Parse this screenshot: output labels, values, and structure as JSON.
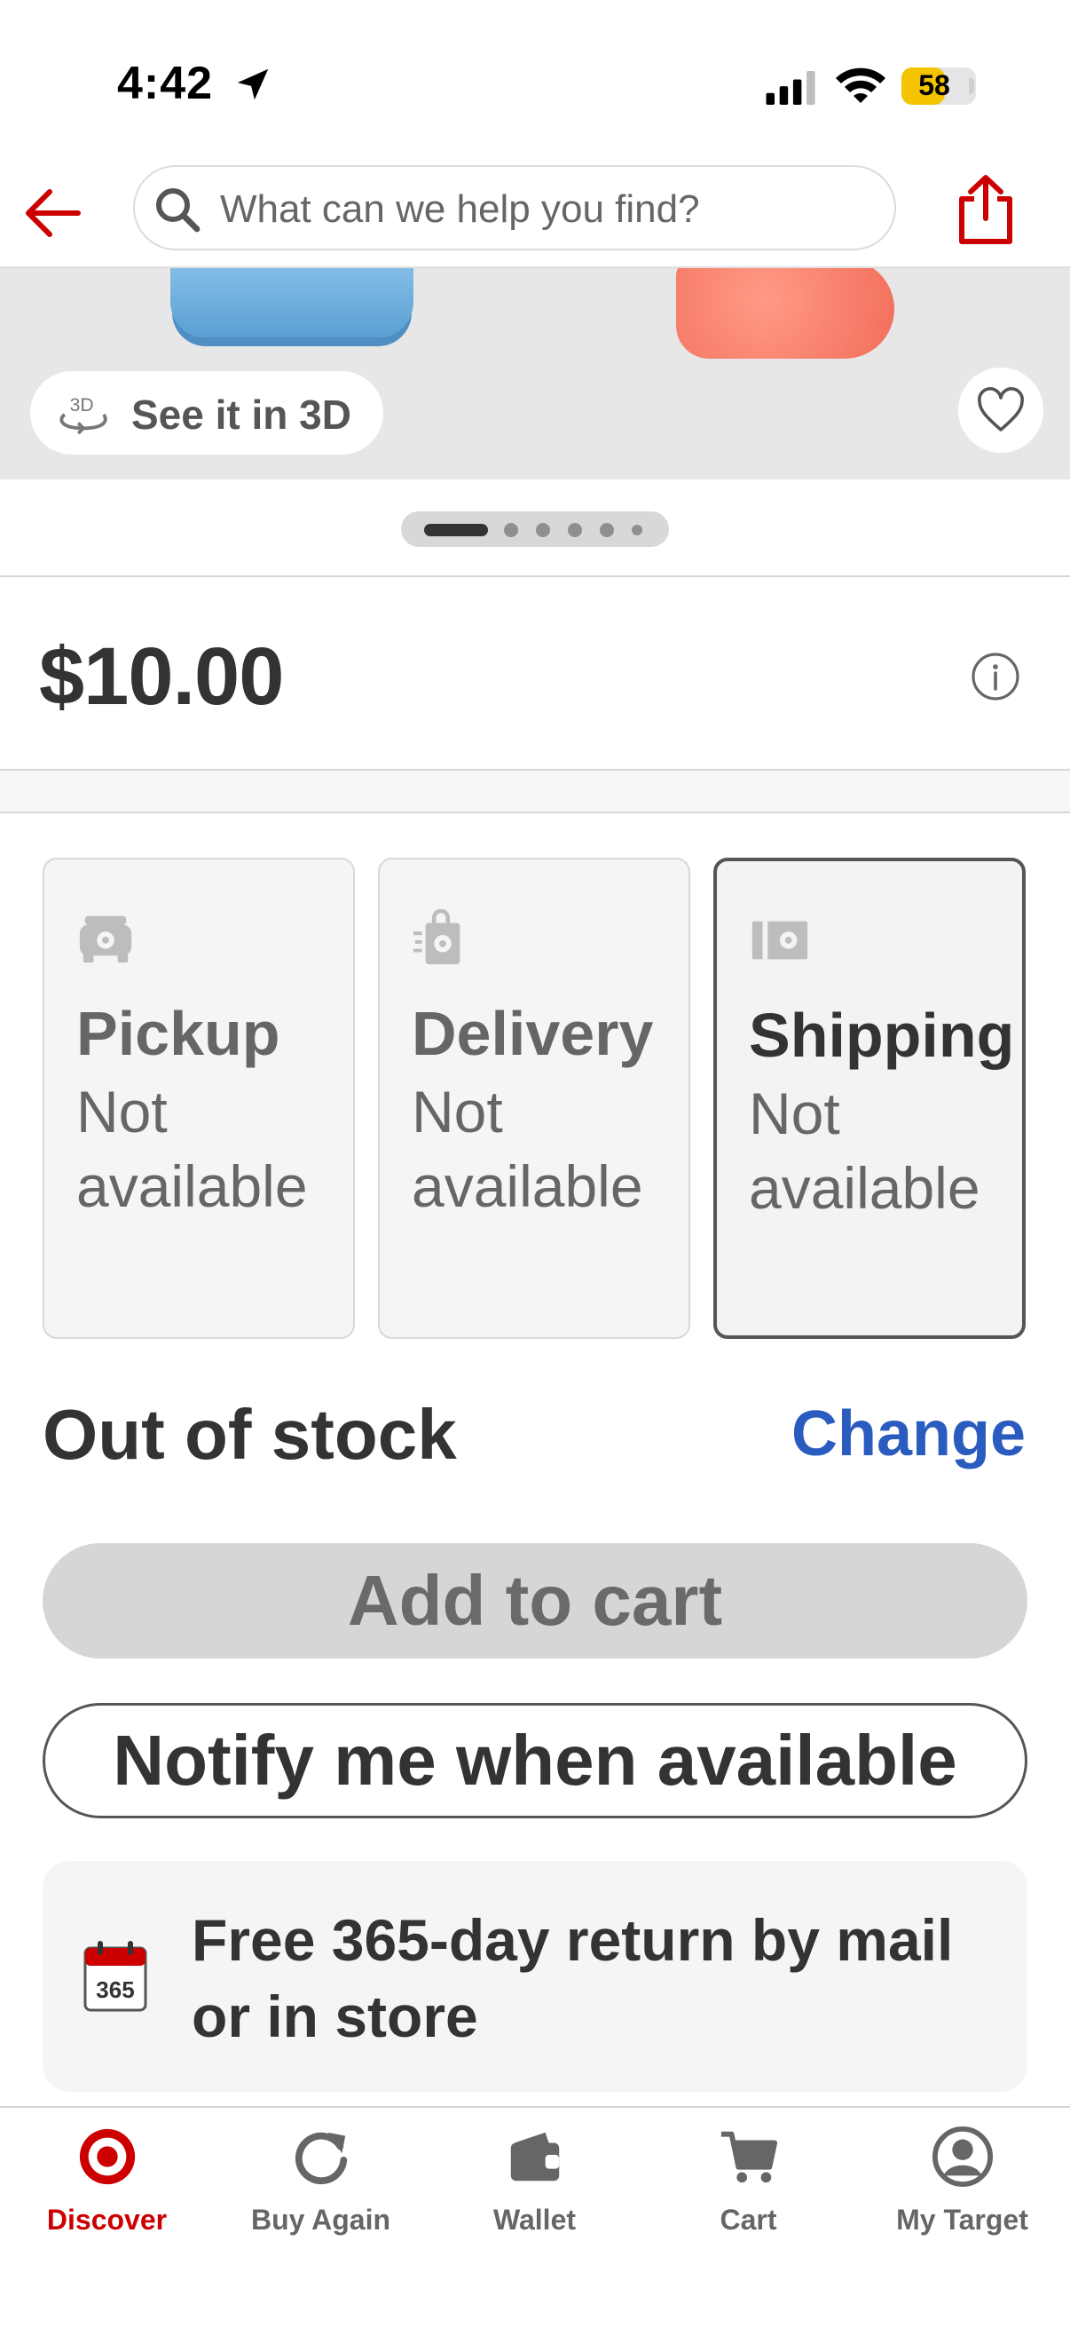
{
  "status_bar": {
    "time": "4:42",
    "battery": "58",
    "battery_level": 0.58
  },
  "header": {
    "search_placeholder": "What can we help you find?"
  },
  "gallery": {
    "view_3d_label": "See it in 3D",
    "dot_count": 6,
    "active_index": 0
  },
  "product": {
    "price": "$10.00"
  },
  "fulfillment": [
    {
      "title": "Pickup",
      "status": "Not available",
      "icon": "pickup-car-icon",
      "selected": false
    },
    {
      "title": "Delivery",
      "status": "Not available",
      "icon": "delivery-bag-icon",
      "selected": false
    },
    {
      "title": "Shipping",
      "status": "Not available",
      "icon": "shipping-box-icon",
      "selected": true
    }
  ],
  "stock": {
    "label": "Out of stock",
    "change": "Change"
  },
  "actions": {
    "add_to_cart": "Add to cart",
    "notify": "Notify me when available"
  },
  "returns": {
    "icon_number": "365",
    "text": "Free 365-day return by mail or in store"
  },
  "tabs": [
    {
      "label": "Discover",
      "icon": "target-bullseye-icon",
      "active": true
    },
    {
      "label": "Buy Again",
      "icon": "refresh-icon",
      "active": false
    },
    {
      "label": "Wallet",
      "icon": "wallet-icon",
      "active": false
    },
    {
      "label": "Cart",
      "icon": "cart-icon",
      "active": false
    },
    {
      "label": "My Target",
      "icon": "account-icon",
      "active": false
    }
  ],
  "colors": {
    "brand_red": "#cc0000",
    "link_blue": "#2a5bbf",
    "battery_yellow": "#f5c400",
    "disabled_gray": "#d6d6d6"
  }
}
